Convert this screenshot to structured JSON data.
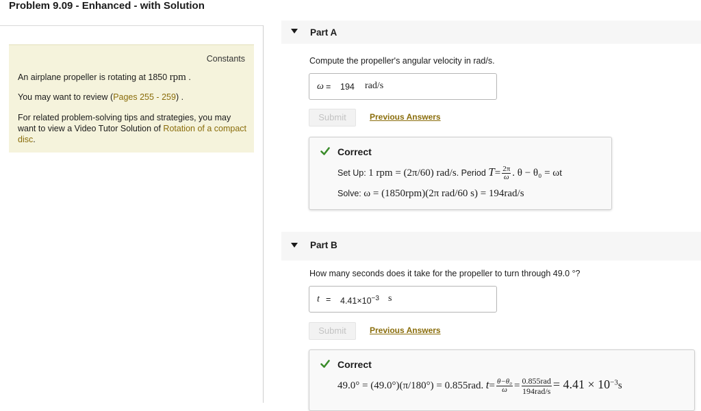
{
  "page": {
    "title": "Problem 9.09 - Enhanced - with Solution"
  },
  "constants": {
    "label": "Constants",
    "statement_text": "An airplane propeller is rotating at 1850",
    "statement_unit": "rpm",
    "statement_end": ".",
    "review_prefix": "You may want to review (",
    "review_link": "Pages 255 - 259",
    "review_suffix": ") .",
    "tips_text": "For related problem-solving tips and strategies, you may want to view a Video Tutor Solution of",
    "tips_link": "Rotation of a compact disc",
    "tips_end": "."
  },
  "part_a": {
    "title": "Part A",
    "question": "Compute the propeller's angular velocity in rad/s.",
    "answer": {
      "variable": "ω",
      "equals": "=",
      "value": "194",
      "unit": "rad/s"
    },
    "submit_label": "Submit",
    "previous_answers_label": "Previous Answers",
    "feedback": {
      "status": "Correct",
      "line1": {
        "prefix": "Set Up:",
        "eq1": "1 rpm = (2π/60) rad/s",
        "mid": ". Period",
        "T": "T",
        "eqs": "=",
        "frac_num": "2π",
        "frac_den": "ω",
        "tail": ". θ − θ₀ = ωt"
      },
      "line2": {
        "prefix": "Solve:",
        "eq": "ω = (1850rpm)(2π rad/60 s) = 194rad/s"
      }
    }
  },
  "part_b": {
    "title": "Part B",
    "question_text": "How many seconds does it take for the propeller to turn through 49.0",
    "question_unit": "°?",
    "answer": {
      "variable": "t",
      "equals": "=",
      "mantissa": "4.41×10",
      "exponent": "−3",
      "unit": "s"
    },
    "submit_label": "Submit",
    "previous_answers_label": "Previous Answers",
    "feedback": {
      "status": "Correct",
      "line1": {
        "eq1": "49.0° = (49.0°)(π/180°) = 0.855rad.",
        "t": "t",
        "eqs1": "=",
        "frac1_num": "θ−θ₀",
        "frac1_den": "ω",
        "eqs2": "=",
        "frac2_num": "0.855rad",
        "frac2_den": "194rad/s",
        "result": "= 4.41 × 10",
        "result_exp": "−3",
        "result_unit": "s"
      }
    }
  },
  "colors": {
    "check": "#3a8c2a",
    "link": "#8a6d0b",
    "panel": "#f5f3dc"
  },
  "icons": {
    "collapse": "caret-down-icon",
    "status": "checkmark-icon"
  }
}
